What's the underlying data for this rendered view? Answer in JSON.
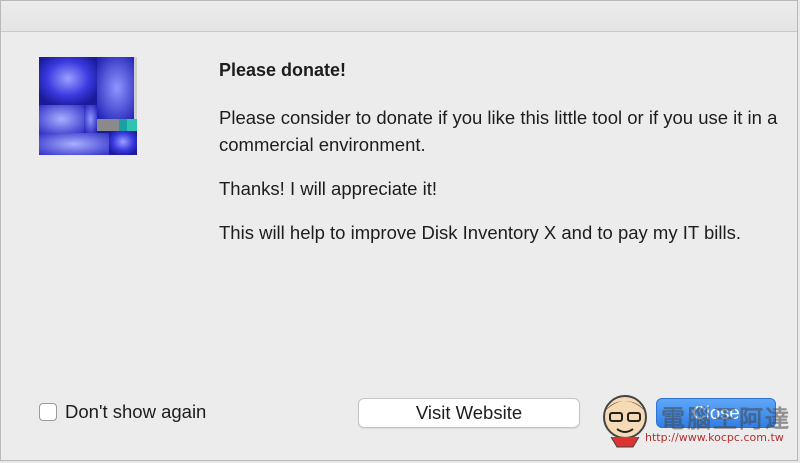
{
  "dialog": {
    "heading": "Please donate!",
    "paragraphs": [
      "Please consider to donate if you like this little tool or if you use it in a commercial environment.",
      "Thanks! I will appreciate it!",
      "This will help to improve Disk Inventory X and to pay my IT bills."
    ],
    "checkbox": {
      "label": "Don't show again",
      "checked": false
    },
    "buttons": {
      "visit_website": "Visit Website",
      "close": "Close"
    },
    "icon": "disk-inventory-treemap-icon"
  },
  "watermark": {
    "text": "電腦王阿達",
    "url": "http://www.kocpc.com.tw"
  },
  "colors": {
    "primary_button": "#2f7fe9",
    "window_background": "#ececec"
  }
}
